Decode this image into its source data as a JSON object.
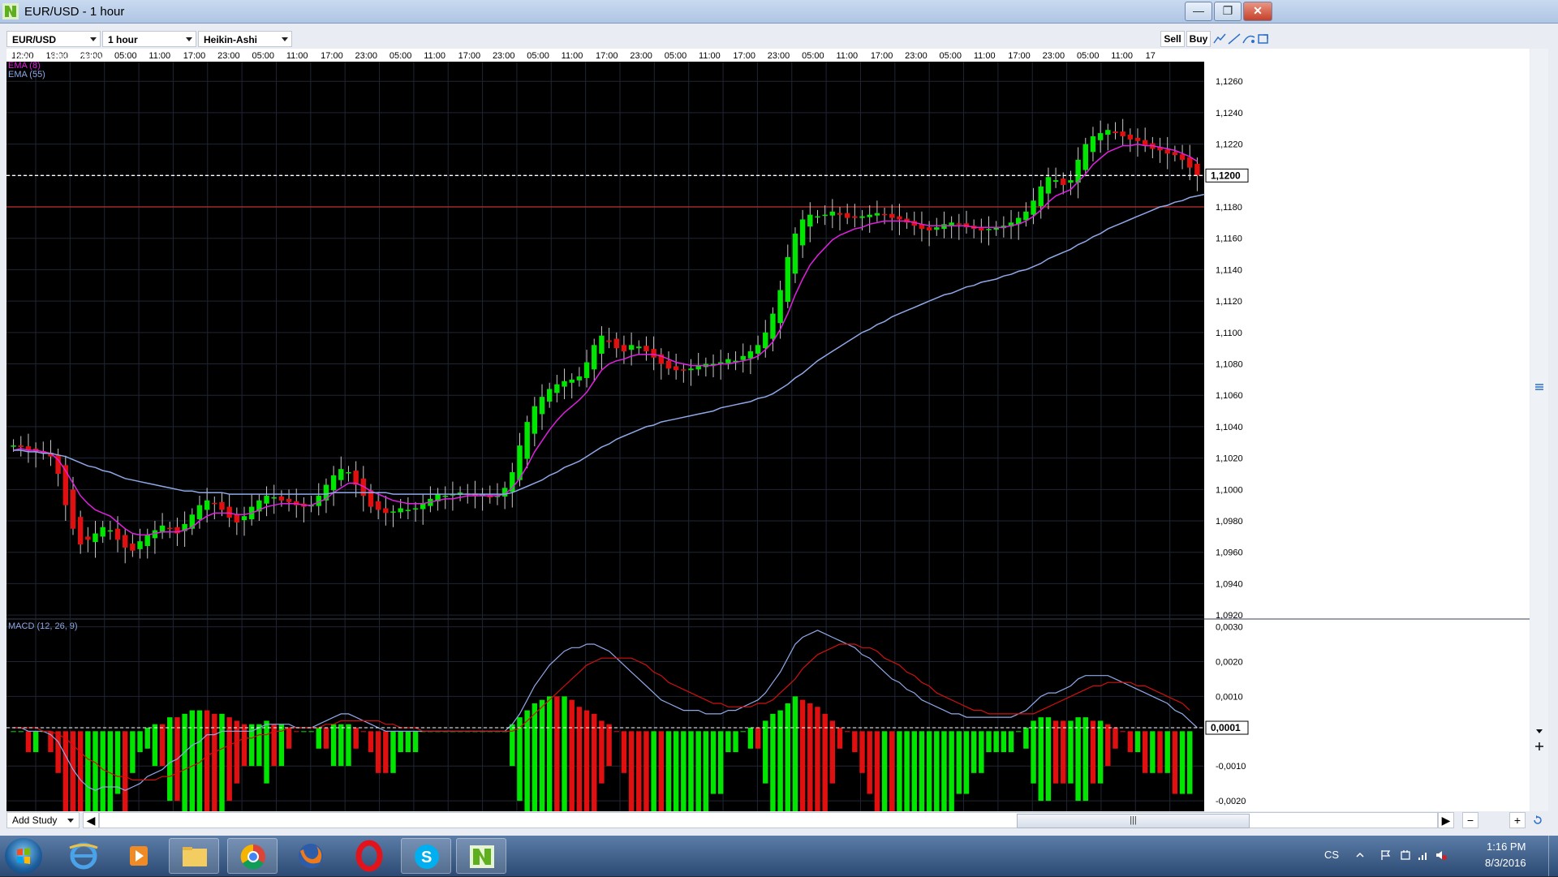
{
  "window": {
    "title": "EUR/USD - 1 hour"
  },
  "toolbar": {
    "symbol": "EUR/USD",
    "interval": "1 hour",
    "chart_style": "Heikin-Ashi",
    "sell_label": "Sell",
    "buy_label": "Buy"
  },
  "bottom": {
    "add_study_label": "Add Study",
    "scroll_thumb": "|||"
  },
  "taskbar": {
    "lang": "CS",
    "time": "1:16 PM",
    "date": "8/3/2016"
  },
  "colors": {
    "background": "#000000",
    "bull_candle": "#00e600",
    "bear_candle": "#e01010",
    "ema8": "#e020e0",
    "ema55": "#8fa8e8",
    "macd_line": "#8fa8e8",
    "signal_line": "#d01010",
    "price_line": "#ffffff",
    "support_line": "#a02a2a"
  },
  "chart_data": {
    "type": "line",
    "title": "EUR/USD (Heikin-Ashi)",
    "x_ticks": [
      "12:00",
      "18:00",
      "23:00",
      "05:00",
      "11:00",
      "17:00",
      "23:00",
      "05:00",
      "11:00",
      "17:00",
      "23:00",
      "05:00",
      "11:00",
      "17:00",
      "23:00",
      "05:00",
      "11:00",
      "17:00",
      "23:00",
      "05:00",
      "11:00",
      "17:00",
      "23:00",
      "05:00",
      "11:00",
      "17:00",
      "23:00",
      "05:00",
      "11:00",
      "17:00",
      "23:00",
      "05:00",
      "11:00",
      "17"
    ],
    "price_panel": {
      "ylim": [
        1.0918,
        1.1272
      ],
      "y_ticks": [
        "1,1260",
        "1,1240",
        "1,1220",
        "1,1200",
        "1,1180",
        "1,1160",
        "1,1140",
        "1,1120",
        "1,1100",
        "1,1080",
        "1,1060",
        "1,1040",
        "1,1020",
        "1,1000",
        "1,0980",
        "1,0960",
        "1,0940",
        "1,0920"
      ],
      "current_price_label": "1,1200",
      "current_price": 1.12,
      "support_level": 1.118,
      "close": [
        1.1028,
        1.1027,
        1.1025,
        1.1024,
        1.1023,
        1.1021,
        1.101,
        1.099,
        1.0975,
        1.0965,
        1.0968,
        1.0972,
        1.0976,
        1.0974,
        1.0968,
        1.0963,
        1.0961,
        1.0967,
        1.0971,
        1.0974,
        1.0977,
        1.0975,
        1.0972,
        1.0978,
        1.0984,
        1.099,
        1.0993,
        1.0991,
        1.0987,
        1.0982,
        1.0979,
        1.0983,
        1.0989,
        1.0993,
        1.0996,
        1.0995,
        1.0993,
        1.0992,
        1.099,
        1.0989,
        1.099,
        1.0996,
        1.1003,
        1.1009,
        1.1013,
        1.1011,
        1.1003,
        1.0996,
        1.0989,
        1.0987,
        1.0985,
        1.0986,
        1.0988,
        1.0987,
        1.0988,
        1.0991,
        1.0994,
        1.0997,
        1.0996,
        1.0997,
        1.0998,
        1.0997,
        1.0996,
        1.0997,
        1.0995,
        1.0996,
        1.1001,
        1.1011,
        1.1028,
        1.1043,
        1.1053,
        1.1059,
        1.1064,
        1.1067,
        1.1069,
        1.107,
        1.1072,
        1.1081,
        1.1092,
        1.1098,
        1.1094,
        1.109,
        1.1088,
        1.1092,
        1.1091,
        1.1088,
        1.1084,
        1.108,
        1.1077,
        1.1076,
        1.1076,
        1.1077,
        1.1079,
        1.108,
        1.108,
        1.1081,
        1.1083,
        1.1082,
        1.1085,
        1.1088,
        1.1092,
        1.11,
        1.1112,
        1.1127,
        1.1148,
        1.1163,
        1.1172,
        1.1175,
        1.1174,
        1.1175,
        1.1177,
        1.1175,
        1.1173,
        1.1173,
        1.1174,
        1.1175,
        1.1176,
        1.1175,
        1.1173,
        1.1172,
        1.117,
        1.1168,
        1.1166,
        1.1165,
        1.1167,
        1.1169,
        1.117,
        1.1169,
        1.1167,
        1.1166,
        1.1165,
        1.1166,
        1.1167,
        1.1168,
        1.117,
        1.1173,
        1.1177,
        1.1184,
        1.1193,
        1.1199,
        1.1197,
        1.1194,
        1.1197,
        1.121,
        1.122,
        1.1225,
        1.1227,
        1.1229,
        1.1227,
        1.1225,
        1.1223,
        1.1222,
        1.1219,
        1.1217,
        1.1216,
        1.1214,
        1.1213,
        1.121,
        1.1205,
        1.12
      ],
      "ema8": [
        1.1025,
        1.1026,
        1.1025,
        1.1025,
        1.1024,
        1.1023,
        1.1019,
        1.1012,
        1.1004,
        1.0996,
        1.0991,
        1.0987,
        1.0985,
        1.0983,
        1.0979,
        1.0975,
        1.0972,
        1.0971,
        1.0971,
        1.0972,
        1.0973,
        1.0973,
        1.0973,
        1.0974,
        1.0976,
        1.098,
        1.0983,
        1.0985,
        1.0985,
        1.0985,
        1.0984,
        1.0984,
        1.0985,
        1.0987,
        1.0989,
        1.099,
        1.0991,
        1.0991,
        1.0991,
        1.099,
        1.099,
        1.0992,
        1.0994,
        1.0998,
        1.1001,
        1.1004,
        1.1004,
        1.1002,
        1.0999,
        1.0997,
        1.0995,
        1.0993,
        1.0992,
        1.0991,
        1.0991,
        1.0991,
        1.0992,
        1.0993,
        1.0994,
        1.0994,
        1.0995,
        1.0996,
        1.0996,
        1.0996,
        1.0996,
        1.0996,
        1.0997,
        1.1001,
        1.1007,
        1.1015,
        1.1024,
        1.1031,
        1.1038,
        1.1044,
        1.1049,
        1.1053,
        1.1057,
        1.1062,
        1.1069,
        1.1076,
        1.108,
        1.1082,
        1.1083,
        1.1085,
        1.1086,
        1.1086,
        1.1086,
        1.1085,
        1.1083,
        1.1081,
        1.108,
        1.1079,
        1.1079,
        1.1079,
        1.1079,
        1.108,
        1.108,
        1.1081,
        1.1082,
        1.1083,
        1.1085,
        1.1089,
        1.1094,
        1.1102,
        1.1112,
        1.1124,
        1.1134,
        1.1143,
        1.1149,
        1.1154,
        1.1159,
        1.1162,
        1.1164,
        1.1166,
        1.1167,
        1.1169,
        1.117,
        1.1171,
        1.1171,
        1.1171,
        1.1171,
        1.117,
        1.1169,
        1.1168,
        1.1168,
        1.1168,
        1.1168,
        1.1168,
        1.1168,
        1.1167,
        1.1167,
        1.1167,
        1.1167,
        1.1167,
        1.1168,
        1.1169,
        1.1171,
        1.1174,
        1.1178,
        1.1183,
        1.1187,
        1.1189,
        1.1191,
        1.1196,
        1.1201,
        1.1207,
        1.1211,
        1.1215,
        1.1217,
        1.1219,
        1.1219,
        1.122,
        1.1219,
        1.1219,
        1.1218,
        1.1217,
        1.1216,
        1.1214,
        1.1212,
        1.1209
      ],
      "ema55": [
        1.1025,
        1.1025,
        1.1024,
        1.1024,
        1.1023,
        1.1023,
        1.1022,
        1.1021,
        1.1019,
        1.1017,
        1.1015,
        1.1014,
        1.1012,
        1.1011,
        1.1009,
        1.1007,
        1.1006,
        1.1005,
        1.1004,
        1.1003,
        1.1002,
        1.1001,
        1.1,
        1.0999,
        1.0999,
        1.0998,
        1.0998,
        1.0998,
        1.0998,
        1.0997,
        1.0997,
        1.0997,
        1.0997,
        1.0997,
        1.0997,
        1.0997,
        1.0997,
        1.0997,
        1.0997,
        1.0997,
        1.0997,
        1.0997,
        1.0997,
        1.0998,
        1.0998,
        1.0998,
        1.0998,
        1.0998,
        1.0998,
        1.0998,
        1.0998,
        1.0997,
        1.0997,
        1.0997,
        1.0997,
        1.0997,
        1.0997,
        1.0997,
        1.0997,
        1.0997,
        1.0997,
        1.0997,
        1.0997,
        1.0997,
        1.0997,
        1.0997,
        1.0997,
        1.0998,
        1.1,
        1.1002,
        1.1004,
        1.1006,
        1.1009,
        1.1011,
        1.1014,
        1.1016,
        1.1018,
        1.1021,
        1.1024,
        1.1027,
        1.1029,
        1.1032,
        1.1034,
        1.1036,
        1.1038,
        1.104,
        1.1041,
        1.1043,
        1.1044,
        1.1045,
        1.1046,
        1.1047,
        1.1048,
        1.1049,
        1.105,
        1.1052,
        1.1053,
        1.1054,
        1.1055,
        1.1056,
        1.1058,
        1.1059,
        1.1061,
        1.1064,
        1.1067,
        1.1071,
        1.1074,
        1.1078,
        1.1082,
        1.1085,
        1.1088,
        1.1091,
        1.1094,
        1.1097,
        1.11,
        1.1102,
        1.1105,
        1.1107,
        1.111,
        1.1112,
        1.1114,
        1.1116,
        1.1118,
        1.112,
        1.1122,
        1.1124,
        1.1125,
        1.1127,
        1.1129,
        1.113,
        1.1132,
        1.1133,
        1.1134,
        1.1136,
        1.1137,
        1.1139,
        1.114,
        1.1142,
        1.1144,
        1.1147,
        1.1149,
        1.1151,
        1.1153,
        1.1156,
        1.1158,
        1.1161,
        1.1163,
        1.1166,
        1.1168,
        1.117,
        1.1172,
        1.1174,
        1.1176,
        1.1178,
        1.118,
        1.1181,
        1.1183,
        1.1184,
        1.1186,
        1.1187,
        1.1188
      ]
    },
    "macd_panel": {
      "title": "MACD (12, 26, 9)",
      "ylim": [
        -0.0023,
        0.0032
      ],
      "y_ticks": [
        "0,0030",
        "0,0020",
        "0,0010",
        "0,0001",
        "-0,0010",
        "-0,0020"
      ],
      "current_label": "0,0001",
      "current_value": 0.0001,
      "macd": [
        0.0001,
        0.0001,
        0.0,
        0.0,
        0.0,
        -0.0001,
        -0.0003,
        -0.0007,
        -0.0011,
        -0.0014,
        -0.0016,
        -0.0017,
        -0.0016,
        -0.0016,
        -0.0016,
        -0.0017,
        -0.0016,
        -0.0015,
        -0.0013,
        -0.0012,
        -0.0011,
        -0.0009,
        -0.0008,
        -0.0006,
        -0.0004,
        -0.0003,
        -0.0001,
        -0.0001,
        -0.0,
        0.0,
        0.0,
        0.0,
        0.0,
        0.0001,
        0.0002,
        0.0002,
        0.0002,
        0.0002,
        0.0001,
        0.0001,
        0.0001,
        0.0002,
        0.0003,
        0.0004,
        0.0005,
        0.0005,
        0.0004,
        0.0003,
        0.0002,
        0.0001,
        0.0,
        -0.0,
        -0.0,
        -0.0,
        -0.0,
        -0.0,
        -0.0,
        0.0,
        0.0,
        0.0,
        0.0,
        0.0,
        0.0,
        0.0,
        0.0,
        0.0,
        0.0,
        0.0002,
        0.0005,
        0.0009,
        0.0013,
        0.0016,
        0.0019,
        0.0021,
        0.0023,
        0.0024,
        0.0024,
        0.0025,
        0.0025,
        0.0024,
        0.0023,
        0.0021,
        0.0019,
        0.0017,
        0.0015,
        0.0013,
        0.0011,
        0.0009,
        0.0008,
        0.0007,
        0.0006,
        0.0006,
        0.0006,
        0.0005,
        0.0005,
        0.0005,
        0.0006,
        0.0006,
        0.0007,
        0.0008,
        0.0009,
        0.0011,
        0.0014,
        0.0017,
        0.0021,
        0.0025,
        0.0027,
        0.0028,
        0.0029,
        0.0028,
        0.0027,
        0.0026,
        0.0025,
        0.0024,
        0.0022,
        0.0021,
        0.0019,
        0.0017,
        0.0015,
        0.0014,
        0.0012,
        0.0011,
        0.0009,
        0.0008,
        0.0007,
        0.0006,
        0.0005,
        0.0005,
        0.0004,
        0.0004,
        0.0004,
        0.0004,
        0.0004,
        0.0004,
        0.0004,
        0.0005,
        0.0006,
        0.0008,
        0.001,
        0.0011,
        0.0011,
        0.0012,
        0.0013,
        0.0015,
        0.0016,
        0.0016,
        0.0016,
        0.0016,
        0.0015,
        0.0014,
        0.0013,
        0.0012,
        0.0011,
        0.001,
        0.0009,
        0.0008,
        0.0006,
        0.0005,
        0.0003,
        0.0001
      ],
      "signal": [
        0.0001,
        0.0001,
        0.0001,
        0.0001,
        0.0,
        -0.0,
        -0.0001,
        -0.0002,
        -0.0004,
        -0.0006,
        -0.0008,
        -0.0009,
        -0.0011,
        -0.0012,
        -0.0013,
        -0.0013,
        -0.0014,
        -0.0014,
        -0.0014,
        -0.0014,
        -0.0013,
        -0.0013,
        -0.0012,
        -0.0011,
        -0.001,
        -0.0009,
        -0.0007,
        -0.0006,
        -0.0005,
        -0.0004,
        -0.0003,
        -0.0002,
        -0.0002,
        -0.0001,
        -0.0001,
        0.0,
        0.0,
        0.0001,
        0.0001,
        0.0001,
        0.0001,
        0.0001,
        0.0002,
        0.0002,
        0.0003,
        0.0003,
        0.0003,
        0.0003,
        0.0003,
        0.0003,
        0.0002,
        0.0002,
        0.0001,
        0.0001,
        0.0001,
        0.0,
        0.0,
        0.0,
        0.0,
        0.0,
        0.0,
        0.0,
        0.0,
        0.0,
        0.0,
        0.0,
        0.0,
        0.0,
        0.0001,
        0.0003,
        0.0005,
        0.0007,
        0.0009,
        0.0011,
        0.0013,
        0.0015,
        0.0017,
        0.0019,
        0.002,
        0.0021,
        0.0021,
        0.0021,
        0.0021,
        0.0021,
        0.002,
        0.0019,
        0.0017,
        0.0016,
        0.0014,
        0.0013,
        0.0012,
        0.0011,
        0.001,
        0.0009,
        0.0008,
        0.0008,
        0.0007,
        0.0007,
        0.0007,
        0.0007,
        0.0008,
        0.0008,
        0.0009,
        0.0011,
        0.0013,
        0.0015,
        0.0018,
        0.002,
        0.0022,
        0.0023,
        0.0024,
        0.0025,
        0.0025,
        0.0025,
        0.0024,
        0.0024,
        0.0023,
        0.0021,
        0.002,
        0.0019,
        0.0017,
        0.0016,
        0.0014,
        0.0013,
        0.0011,
        0.001,
        0.0009,
        0.0008,
        0.0007,
        0.0006,
        0.0006,
        0.0005,
        0.0005,
        0.0005,
        0.0005,
        0.0005,
        0.0005,
        0.0005,
        0.0006,
        0.0007,
        0.0008,
        0.0009,
        0.001,
        0.0011,
        0.0012,
        0.0013,
        0.0013,
        0.0014,
        0.0014,
        0.0014,
        0.0014,
        0.0013,
        0.0013,
        0.0012,
        0.0011,
        0.001,
        0.0009,
        0.0008,
        0.0006
      ]
    }
  }
}
